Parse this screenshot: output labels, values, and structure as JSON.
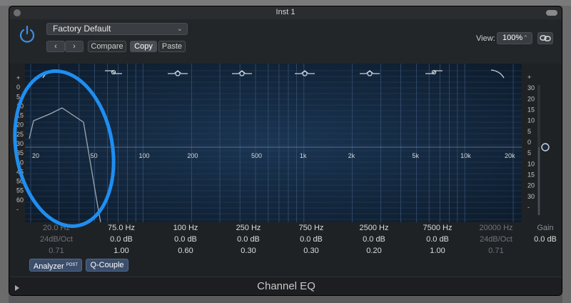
{
  "window": {
    "title": "Inst 1"
  },
  "header": {
    "preset": "Factory Default",
    "compare_label": "Compare",
    "copy_label": "Copy",
    "paste_label": "Paste",
    "view_label": "View:",
    "view_value": "100%"
  },
  "graph": {
    "left_db_ticks": [
      "+",
      "0",
      "5",
      "10",
      "15",
      "20",
      "25",
      "30",
      "35",
      "40",
      "45",
      "50",
      "55",
      "60",
      "-"
    ],
    "freq_ticks": [
      "20",
      "50",
      "100",
      "200",
      "500",
      "1k",
      "2k",
      "5k",
      "10k",
      "20k"
    ],
    "right_db_ticks": [
      "+",
      "30",
      "20",
      "15",
      "10",
      "5",
      "0",
      "5",
      "10",
      "15",
      "20",
      "30",
      "-"
    ]
  },
  "bands": [
    {
      "freq": "20.0 Hz",
      "gain": "24dB/Oct",
      "q": "0.71",
      "active": false
    },
    {
      "freq": "75.0 Hz",
      "gain": "0.0 dB",
      "q": "1.00",
      "active": true
    },
    {
      "freq": "100 Hz",
      "gain": "0.0 dB",
      "q": "0.60",
      "active": true
    },
    {
      "freq": "250 Hz",
      "gain": "0.0 dB",
      "q": "0.30",
      "active": true
    },
    {
      "freq": "750 Hz",
      "gain": "0.0 dB",
      "q": "0.30",
      "active": true
    },
    {
      "freq": "2500 Hz",
      "gain": "0.0 dB",
      "q": "0.20",
      "active": true
    },
    {
      "freq": "7500 Hz",
      "gain": "0.0 dB",
      "q": "1.00",
      "active": true
    },
    {
      "freq": "20000 Hz",
      "gain": "24dB/Oct",
      "q": "0.71",
      "active": false
    }
  ],
  "gain": {
    "label": "Gain",
    "value": "0.0 dB"
  },
  "buttons": {
    "analyzer_label": "Analyzer",
    "analyzer_sup": "POST",
    "qcouple_label": "Q-Couple"
  },
  "footer": {
    "title": "Channel EQ"
  },
  "colors": {
    "accent": "#1f8ef1",
    "panel": "#1f2225",
    "graph_bg": "#0f2236"
  }
}
